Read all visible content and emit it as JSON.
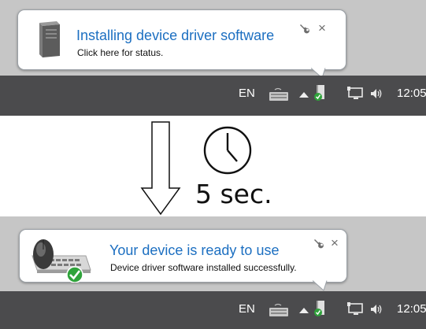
{
  "before": {
    "balloon": {
      "title": "Installing device driver software",
      "subtitle": "Click here for status."
    },
    "taskbar": {
      "language": "EN",
      "clock": "12:05"
    }
  },
  "transition": {
    "delay_label": "5 sec."
  },
  "after": {
    "balloon": {
      "title": "Your device is ready to use",
      "subtitle": "Device driver software installed successfully."
    },
    "taskbar": {
      "language": "EN",
      "clock": "12:05"
    }
  },
  "icons": {
    "balloon_actions": [
      "wrench-icon",
      "close-icon"
    ],
    "close_glyph": "×",
    "tray": [
      "keyboard-icon",
      "show-hidden-icons-arrow",
      "device-tray-icon",
      "network-monitor-icon",
      "volume-icon"
    ],
    "before_icon": "server-tower-icon",
    "after_icon": "mouse-keyboard-check-icon"
  },
  "colors": {
    "title_blue": "#1c6fc1",
    "taskbar": "#4b4b4d",
    "backdrop": "#c6c6c6",
    "check_green": "#2fa33b"
  }
}
